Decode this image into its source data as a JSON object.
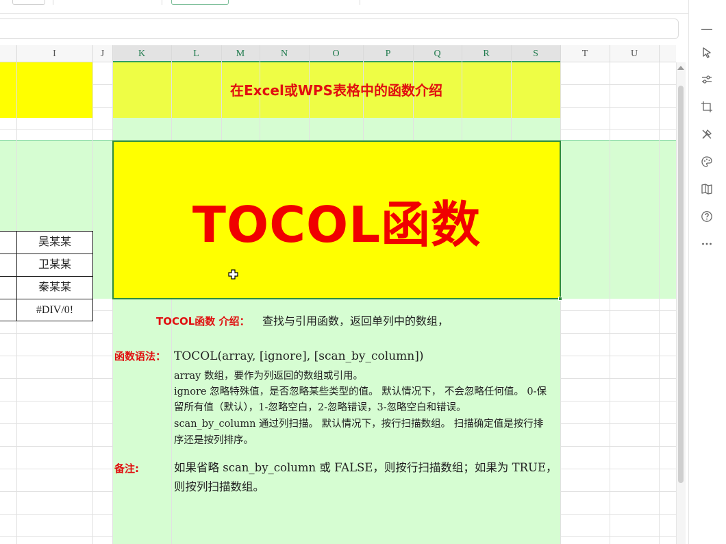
{
  "toolbar": {},
  "columns": [
    {
      "name": "I",
      "selected": false
    },
    {
      "name": "J",
      "selected": false
    },
    {
      "name": "K",
      "selected": true
    },
    {
      "name": "L",
      "selected": true
    },
    {
      "name": "M",
      "selected": true
    },
    {
      "name": "N",
      "selected": true
    },
    {
      "name": "O",
      "selected": true
    },
    {
      "name": "P",
      "selected": true
    },
    {
      "name": "Q",
      "selected": true
    },
    {
      "name": "R",
      "selected": true
    },
    {
      "name": "S",
      "selected": true
    },
    {
      "name": "T",
      "selected": false
    },
    {
      "name": "U",
      "selected": false
    }
  ],
  "names_table": [
    "吴某某",
    "卫某某",
    "秦某某",
    "#DIV/0!"
  ],
  "card": {
    "subtitle": "在Excel或WPS表格中的函数介绍",
    "title": "TOCOL函数",
    "intro_label": "TOCOL函数  介绍：",
    "intro_text": "查找与引用函数，返回单列中的数组，",
    "syntax_label": "函数语法：",
    "syntax_text": "TOCOL(array, [ignore], [scan_by_column])",
    "syntax_details": [
      "array 数组，要作为列返回的数组或引用。",
      "ignore 忽略特殊值，是否忽略某些类型的值。 默认情况下， 不会忽略任何值。 0-保",
      "留所有值（默认），1-忽略空白，2-忽略错误，3-忽略空白和错误。",
      "scan_by_column 通过列扫描。 默认情况下，按行扫描数组。 扫描确定值是按行排",
      "序还是按列排序。"
    ],
    "note_label": "备注:",
    "note_lines": [
      "如果省略 scan_by_column 或 FALSE，则按行扫描数组；如果为 TRUE，",
      "则按列扫描数组。"
    ]
  },
  "side_panel": {
    "icons": [
      "cursor-icon",
      "sliders-icon",
      "crop-icon",
      "tools-icon",
      "palette-icon",
      "book-map-icon",
      "help-icon",
      "more-icon"
    ]
  },
  "colors": {
    "yellow": "#ffff00",
    "light_yellow": "#eefd45",
    "light_green": "#d6fdd2",
    "title_red": "#f00000",
    "selection_green": "#2e8b3e"
  }
}
